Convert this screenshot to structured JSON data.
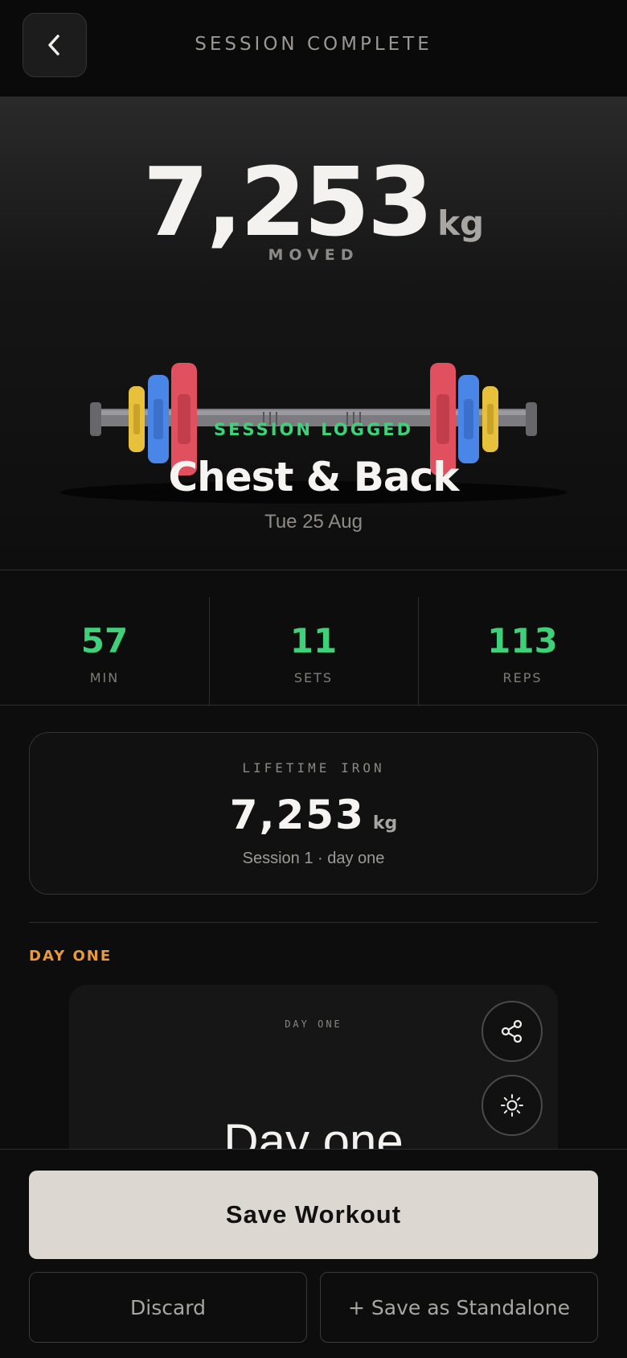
{
  "header": {
    "title": "SESSION COMPLETE",
    "back_icon": "chevron-left-icon"
  },
  "hero": {
    "total_value": "7,253",
    "total_unit": "kg",
    "moved_label": "MOVED",
    "status": "SESSION LOGGED",
    "workout_name": "Chest & Back",
    "date": "Tue 25 Aug",
    "plate_colors": {
      "red": "#e0505e",
      "blue": "#4a86e8",
      "yellow": "#e8c13c"
    }
  },
  "stats": [
    {
      "value": "57",
      "label": "MIN"
    },
    {
      "value": "11",
      "label": "SETS"
    },
    {
      "value": "113",
      "label": "REPS"
    }
  ],
  "lifetime": {
    "label": "LIFETIME IRON",
    "value": "7,253",
    "unit": "kg",
    "subtitle": "Session 1 · day one"
  },
  "section": {
    "label": "DAY ONE"
  },
  "card": {
    "label": "DAY ONE",
    "title": "Day one",
    "share_icon": "share-icon",
    "theme_icon": "sun-icon"
  },
  "footer": {
    "save_label": "Save Workout",
    "discard_label": "Discard",
    "standalone_label": "+ Save as Standalone"
  },
  "colors": {
    "accent_green": "#3fd07a",
    "accent_orange": "#e89a3c",
    "background": "#0d0d0d"
  }
}
